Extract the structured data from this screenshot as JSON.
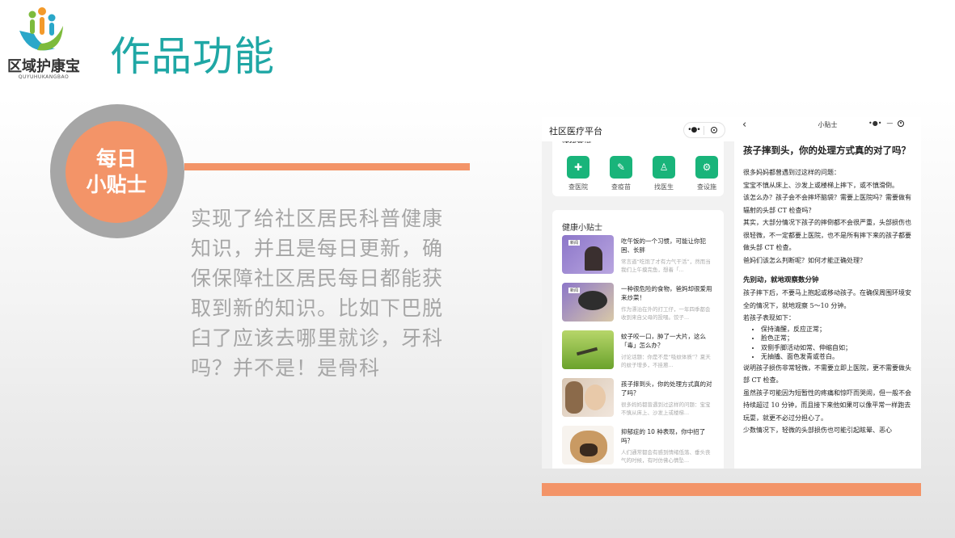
{
  "logo": {
    "brand_cn": "区域护康宝",
    "brand_en": "QUYUHUKANGBAO"
  },
  "slide_title": "作品功能",
  "badge": {
    "line1": "每日",
    "line2": "小贴士"
  },
  "description": "实现了给社区居民科普健康知识，并且是每日更新，确保保障社区居民每日都能获取到新的知识。比如下巴脱臼了应该去哪里就诊，牙科吗？并不是！是骨科",
  "colors": {
    "accent": "#f39468",
    "title": "#1fa7a5",
    "green": "#19b47a",
    "gray": "#a6a6a6"
  },
  "left_screen": {
    "nav_title": "社区医疗平台",
    "quick_title": "快捷查询",
    "quick_items": [
      {
        "label": "查医院",
        "icon": "hospital-icon",
        "glyph": "✚"
      },
      {
        "label": "查疫苗",
        "icon": "syringe-icon",
        "glyph": "✎"
      },
      {
        "label": "找医生",
        "icon": "doctor-icon",
        "glyph": "♙"
      },
      {
        "label": "查设施",
        "icon": "settings-icon",
        "glyph": "⚙"
      }
    ],
    "tips_title": "健康小贴士",
    "tips": [
      {
        "title": "吃午饭的一个习惯，可能让你犯困、长胖",
        "summary": "常言道“吃饱了才有力气干活”，然而当我们上午摸完鱼，想着「...",
        "tag": "新闻"
      },
      {
        "title": "一种很危险的食物，爸妈却很爱用来炒菜！",
        "summary": "作为漂泊在外的打工仔，一年四季都会收到来自父母的投喂。饺子...",
        "tag": "新闻"
      },
      {
        "title": "蚊子咬一口，肿了一大片，这么「毒」怎么办？",
        "summary": "讨论话题：你是不是“吸蚊体质”？夏天的蚊子增多，不挂蒽...",
        "tag": ""
      },
      {
        "title": "孩子摔到头，你的处理方式真的对了吗？",
        "summary": "很多妈妈都曾遇到过这样的问题：宝宝不慎从床上、沙发上或楼梯...",
        "tag": ""
      },
      {
        "title": "抑郁症的 10 种表现，你中招了吗？",
        "summary": "人们通常都会有感到情绪低落、垂头丧气的时候，有时仿佛心情坠...",
        "tag": ""
      }
    ]
  },
  "right_screen": {
    "nav_title": "小贴士",
    "article_title": "孩子摔到头，你的处理方式真的对了吗？",
    "p1": "很多妈妈都曾遇到过这样的问题：",
    "p2": "宝宝不慎从床上、沙发上或楼梯上摔下，或不慎滑倒。",
    "p3": "该怎么办？孩子会不会摔坏脑袋？需要上医院吗？需要做有辐射的头部 CT 检查吗？",
    "p4": "其实，大部分情况下孩子的摔倒都不会很严重，头部损伤也很轻微，不一定都要上医院，也不是所有摔下来的孩子都要做头部 CT 检查。",
    "p5": "爸妈们该怎么判断呢？如何才能正确处理？",
    "h2": "先别动，就地观察数分钟",
    "p6": "孩子摔下后，不要马上抱起或移动孩子。在确保周围环境安全的情况下，就地观察 5～10 分钟。",
    "p7": "若孩子表现如下：",
    "list": [
      "保持清醒，反应正常；",
      "脸色正常；",
      "双侧手脚活动如常、伸缩自如；",
      "无抽搐、面色发青或苍白。"
    ],
    "p8": "说明孩子损伤非常轻微，不需要立即上医院，更不需要做头部 CT 检查。",
    "p9": "虽然孩子可能因为短暂性的疼痛和惊吓而哭闹，但一般不会持续超过 10 分钟，而且接下来他如果可以像平常一样跑去玩耍，就更不必过分担心了。",
    "p10": "少数情况下，轻微的头部损伤也可能引起眩晕、恶心"
  }
}
